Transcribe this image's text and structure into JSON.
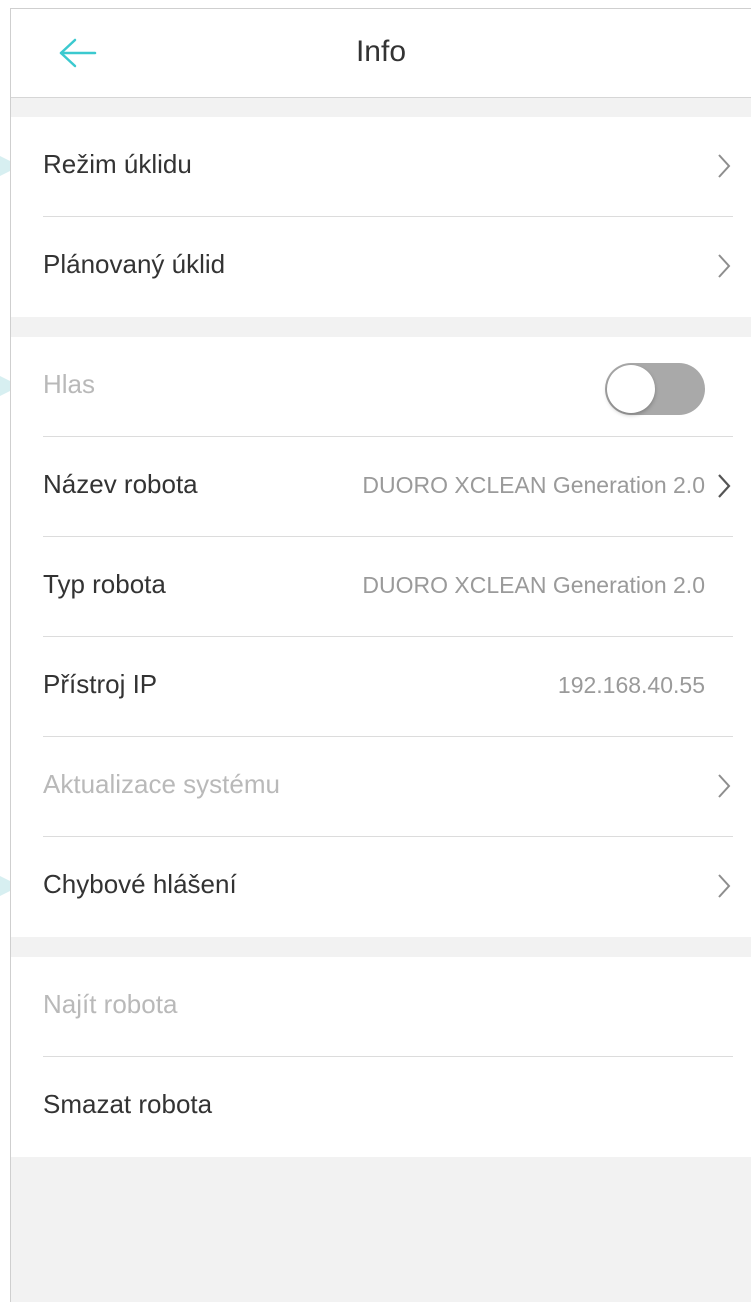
{
  "header": {
    "title": "Info",
    "back_icon": "arrow-left-icon",
    "accent": "#3bc9cf"
  },
  "groups": [
    {
      "rows": [
        {
          "label": "Režim úklidu",
          "chevron": true
        },
        {
          "label": "Plánovaný úklid",
          "chevron": true
        }
      ]
    },
    {
      "rows": [
        {
          "label": "Hlas",
          "toggle": false
        },
        {
          "label": "Název robota",
          "value": "DUORO XCLEAN Generation 2.0",
          "chevron": true
        },
        {
          "label": "Typ robota",
          "value": "DUORO XCLEAN Generation 2.0"
        },
        {
          "label": "Přístroj IP",
          "value": "192.168.40.55"
        },
        {
          "label": "Aktualizace systému",
          "chevron": true
        },
        {
          "label": "Chybové hlášení",
          "chevron": true
        }
      ]
    },
    {
      "rows": [
        {
          "label": "Najít robota"
        },
        {
          "label": "Smazat robota"
        }
      ]
    }
  ],
  "colors": {
    "text": "#333333",
    "dim_text": "#b9b9b9",
    "value_text": "#9a9a9a",
    "background": "#f2f2f2",
    "toggle_off": "#a9a9a9"
  }
}
